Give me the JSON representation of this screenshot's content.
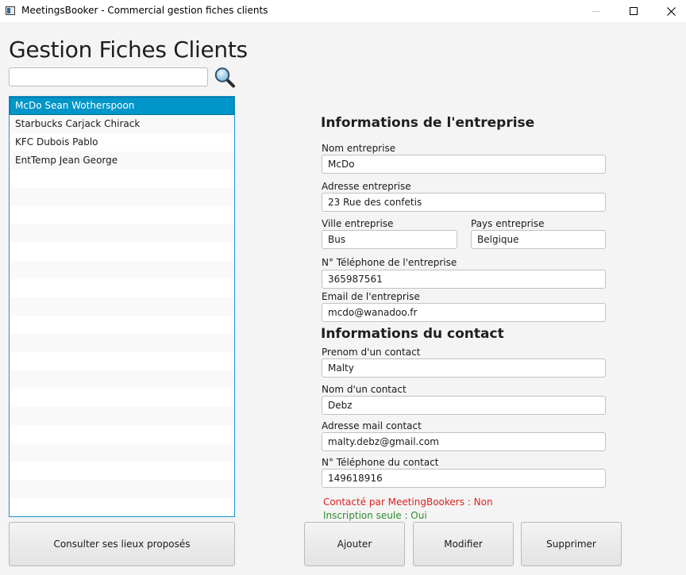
{
  "window": {
    "title": "MeetingsBooker - Commercial gestion fiches clients"
  },
  "page_title": "Gestion Fiches Clients",
  "search": {
    "value": "",
    "placeholder": ""
  },
  "client_list": {
    "items": [
      "McDo Sean Wotherspoon",
      "Starbucks Carjack Chirack",
      "KFC Dubois Pablo",
      "EntTemp Jean George"
    ],
    "selected_index": 0
  },
  "company_section": {
    "title": "Informations de l'entreprise",
    "name_label": "Nom entreprise",
    "name_value": "McDo",
    "address_label": "Adresse entreprise",
    "address_value": "23 Rue des confetis",
    "city_label": "Ville entreprise",
    "city_value": "Bus",
    "country_label": "Pays entreprise",
    "country_value": "Belgique",
    "phone_label": "N° Téléphone de l'entreprise",
    "phone_value": "365987561",
    "email_label": "Email de l'entreprise",
    "email_value": "mcdo@wanadoo.fr"
  },
  "contact_section": {
    "title": "Informations du contact",
    "firstname_label": "Prenom d'un contact",
    "firstname_value": "Malty",
    "lastname_label": "Nom d'un contact",
    "lastname_value": "Debz",
    "email_label": "Adresse mail contact",
    "email_value": "malty.debz@gmail.com",
    "phone_label": "N° Téléphone du contact",
    "phone_value": "149618916"
  },
  "status": {
    "contacted": "Contacté par MeetingBookers : Non",
    "contacted_color": "#e02020",
    "registration": "Inscription seule : Oui",
    "registration_color": "#2e8b2e"
  },
  "buttons": {
    "consult": "Consulter ses lieux proposés",
    "add": "Ajouter",
    "modify": "Modifier",
    "delete": "Supprimer"
  },
  "colors": {
    "selection": "#0096c9",
    "list_border": "#1a96d1"
  }
}
